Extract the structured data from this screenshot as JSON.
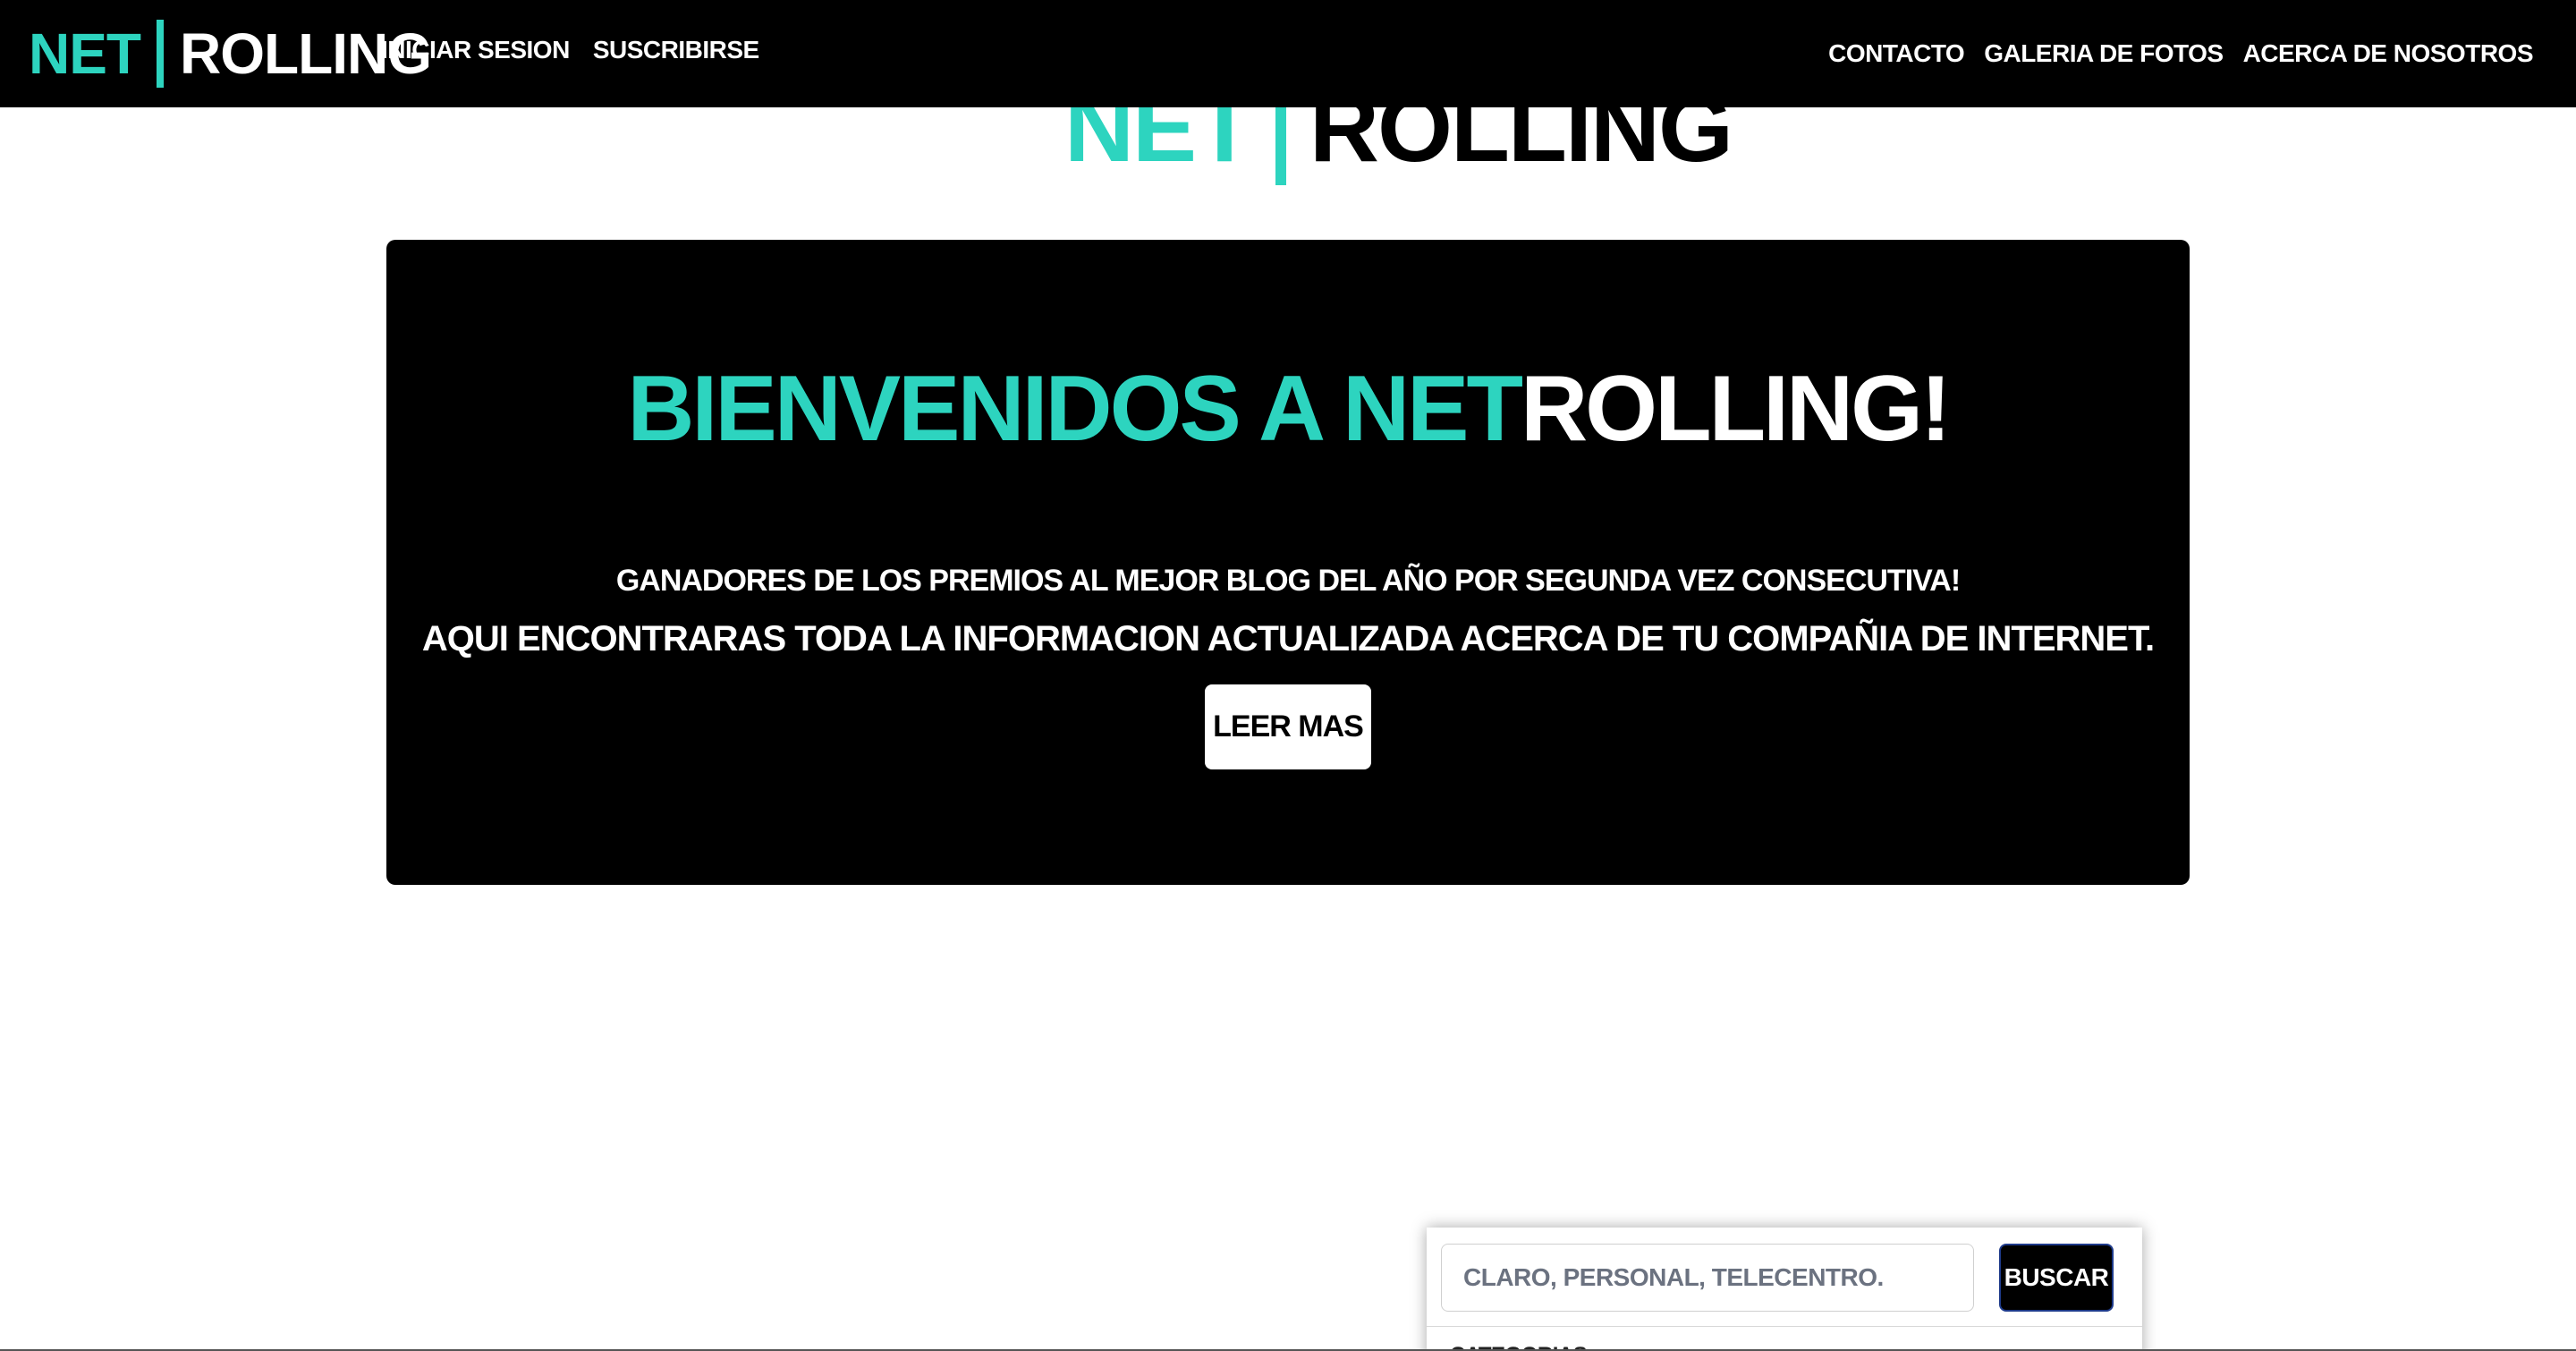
{
  "navbar": {
    "brand_net": "NET",
    "brand_rolling": "ROLLING",
    "left_links": [
      "INICIAR SESION",
      "SUSCRIBIRSE"
    ],
    "right_links": [
      "CONTACTO",
      "GALERIA DE FOTOS",
      "ACERCA DE NOSOTROS"
    ]
  },
  "hero_logo": {
    "net": "NET",
    "rolling": "ROLLING"
  },
  "jumbotron": {
    "title_accent": "BIENVENIDOS A NET",
    "title_rest": "ROLLING!",
    "subtitle_1": "GANADORES DE LOS PREMIOS AL MEJOR BLOG DEL AÑO POR SEGUNDA VEZ CONSECUTIVA!",
    "subtitle_2": "AQUI ENCONTRARAS TODA LA INFORMACION ACTUALIZADA ACERCA DE TU COMPAÑIA DE INTERNET.",
    "button_label": "LEER MAS"
  },
  "search": {
    "placeholder": "CLARO, PERSONAL, TELECENTRO.",
    "button_label": "BUSCAR",
    "categories_label": "CATEGORIAS"
  },
  "colors": {
    "accent": "#2dd4bf",
    "background_dark": "#000000",
    "background_light": "#ffffff"
  }
}
